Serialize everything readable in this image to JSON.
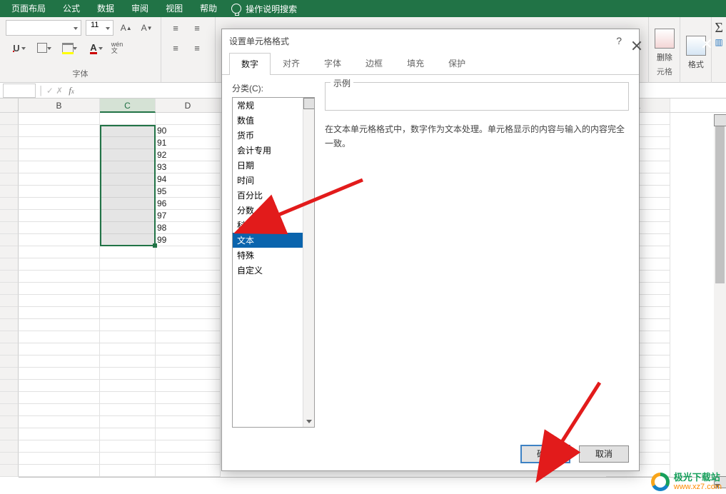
{
  "ribbon": {
    "tabs": [
      "页面布局",
      "公式",
      "数据",
      "审阅",
      "视图",
      "帮助"
    ],
    "search_placeholder": "操作说明搜索"
  },
  "font_group": {
    "label": "字体",
    "font_size": "11"
  },
  "ribbon_right": {
    "delete": "删除",
    "format": "格式",
    "font_label_cut": "元格"
  },
  "grid": {
    "columns": [
      "B",
      "C",
      "D"
    ],
    "column_right": "L",
    "rows": [
      {
        "d": "90"
      },
      {
        "d": "91"
      },
      {
        "d": "92"
      },
      {
        "d": "93"
      },
      {
        "d": "94"
      },
      {
        "d": "95"
      },
      {
        "d": "96"
      },
      {
        "d": "97"
      },
      {
        "d": "98"
      },
      {
        "d": "99"
      }
    ]
  },
  "dialog": {
    "title": "设置单元格格式",
    "help": "?",
    "tabs": [
      "数字",
      "对齐",
      "字体",
      "边框",
      "填充",
      "保护"
    ],
    "active_tab": 0,
    "category_label": "分类(C):",
    "categories": [
      "常规",
      "数值",
      "货币",
      "会计专用",
      "日期",
      "时间",
      "百分比",
      "分数",
      "科学记数",
      "文本",
      "特殊",
      "自定义"
    ],
    "selected_category_index": 9,
    "example_label": "示例",
    "description": "在文本单元格格式中，数字作为文本处理。单元格显示的内容与输入的内容完全一致。",
    "ok": "确定",
    "cancel": "取消"
  },
  "watermark": {
    "title": "极光下载站",
    "url": "www.xz7.com"
  }
}
